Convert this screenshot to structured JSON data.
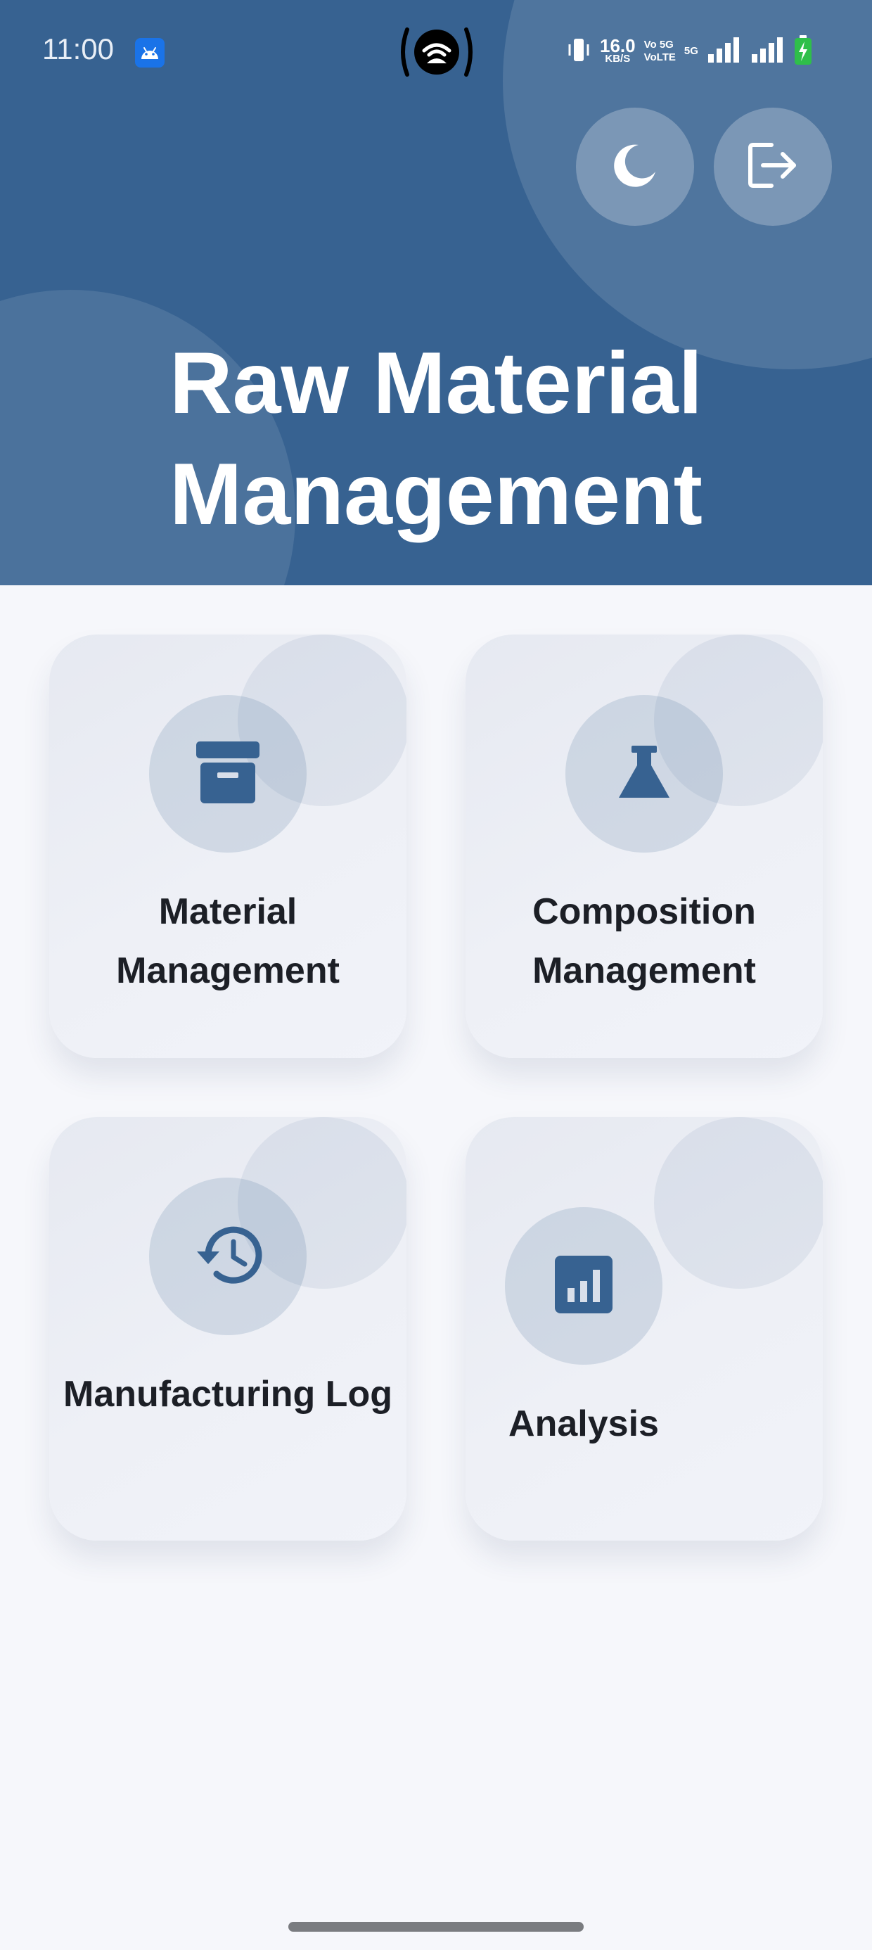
{
  "status_bar": {
    "time": "11:00",
    "speed_value": "16.0",
    "speed_unit": "KB/S",
    "net_line1": "Vo 5G",
    "net_line2": "VoLTE",
    "net_badge": "5G"
  },
  "header": {
    "title": "Raw Material Management",
    "theme_button_icon": "moon-icon",
    "logout_button_icon": "logout-icon"
  },
  "cards": [
    {
      "label": "Material Management",
      "icon": "archive-box-icon"
    },
    {
      "label": "Composition Management",
      "icon": "flask-icon"
    },
    {
      "label": "Manufacturing Log",
      "icon": "history-icon"
    },
    {
      "label": "Analysis",
      "icon": "bar-chart-icon"
    }
  ],
  "colors": {
    "primary": "#376291",
    "background": "#f6f7fb",
    "card_text": "#1c1f26",
    "icon": "#376291"
  }
}
